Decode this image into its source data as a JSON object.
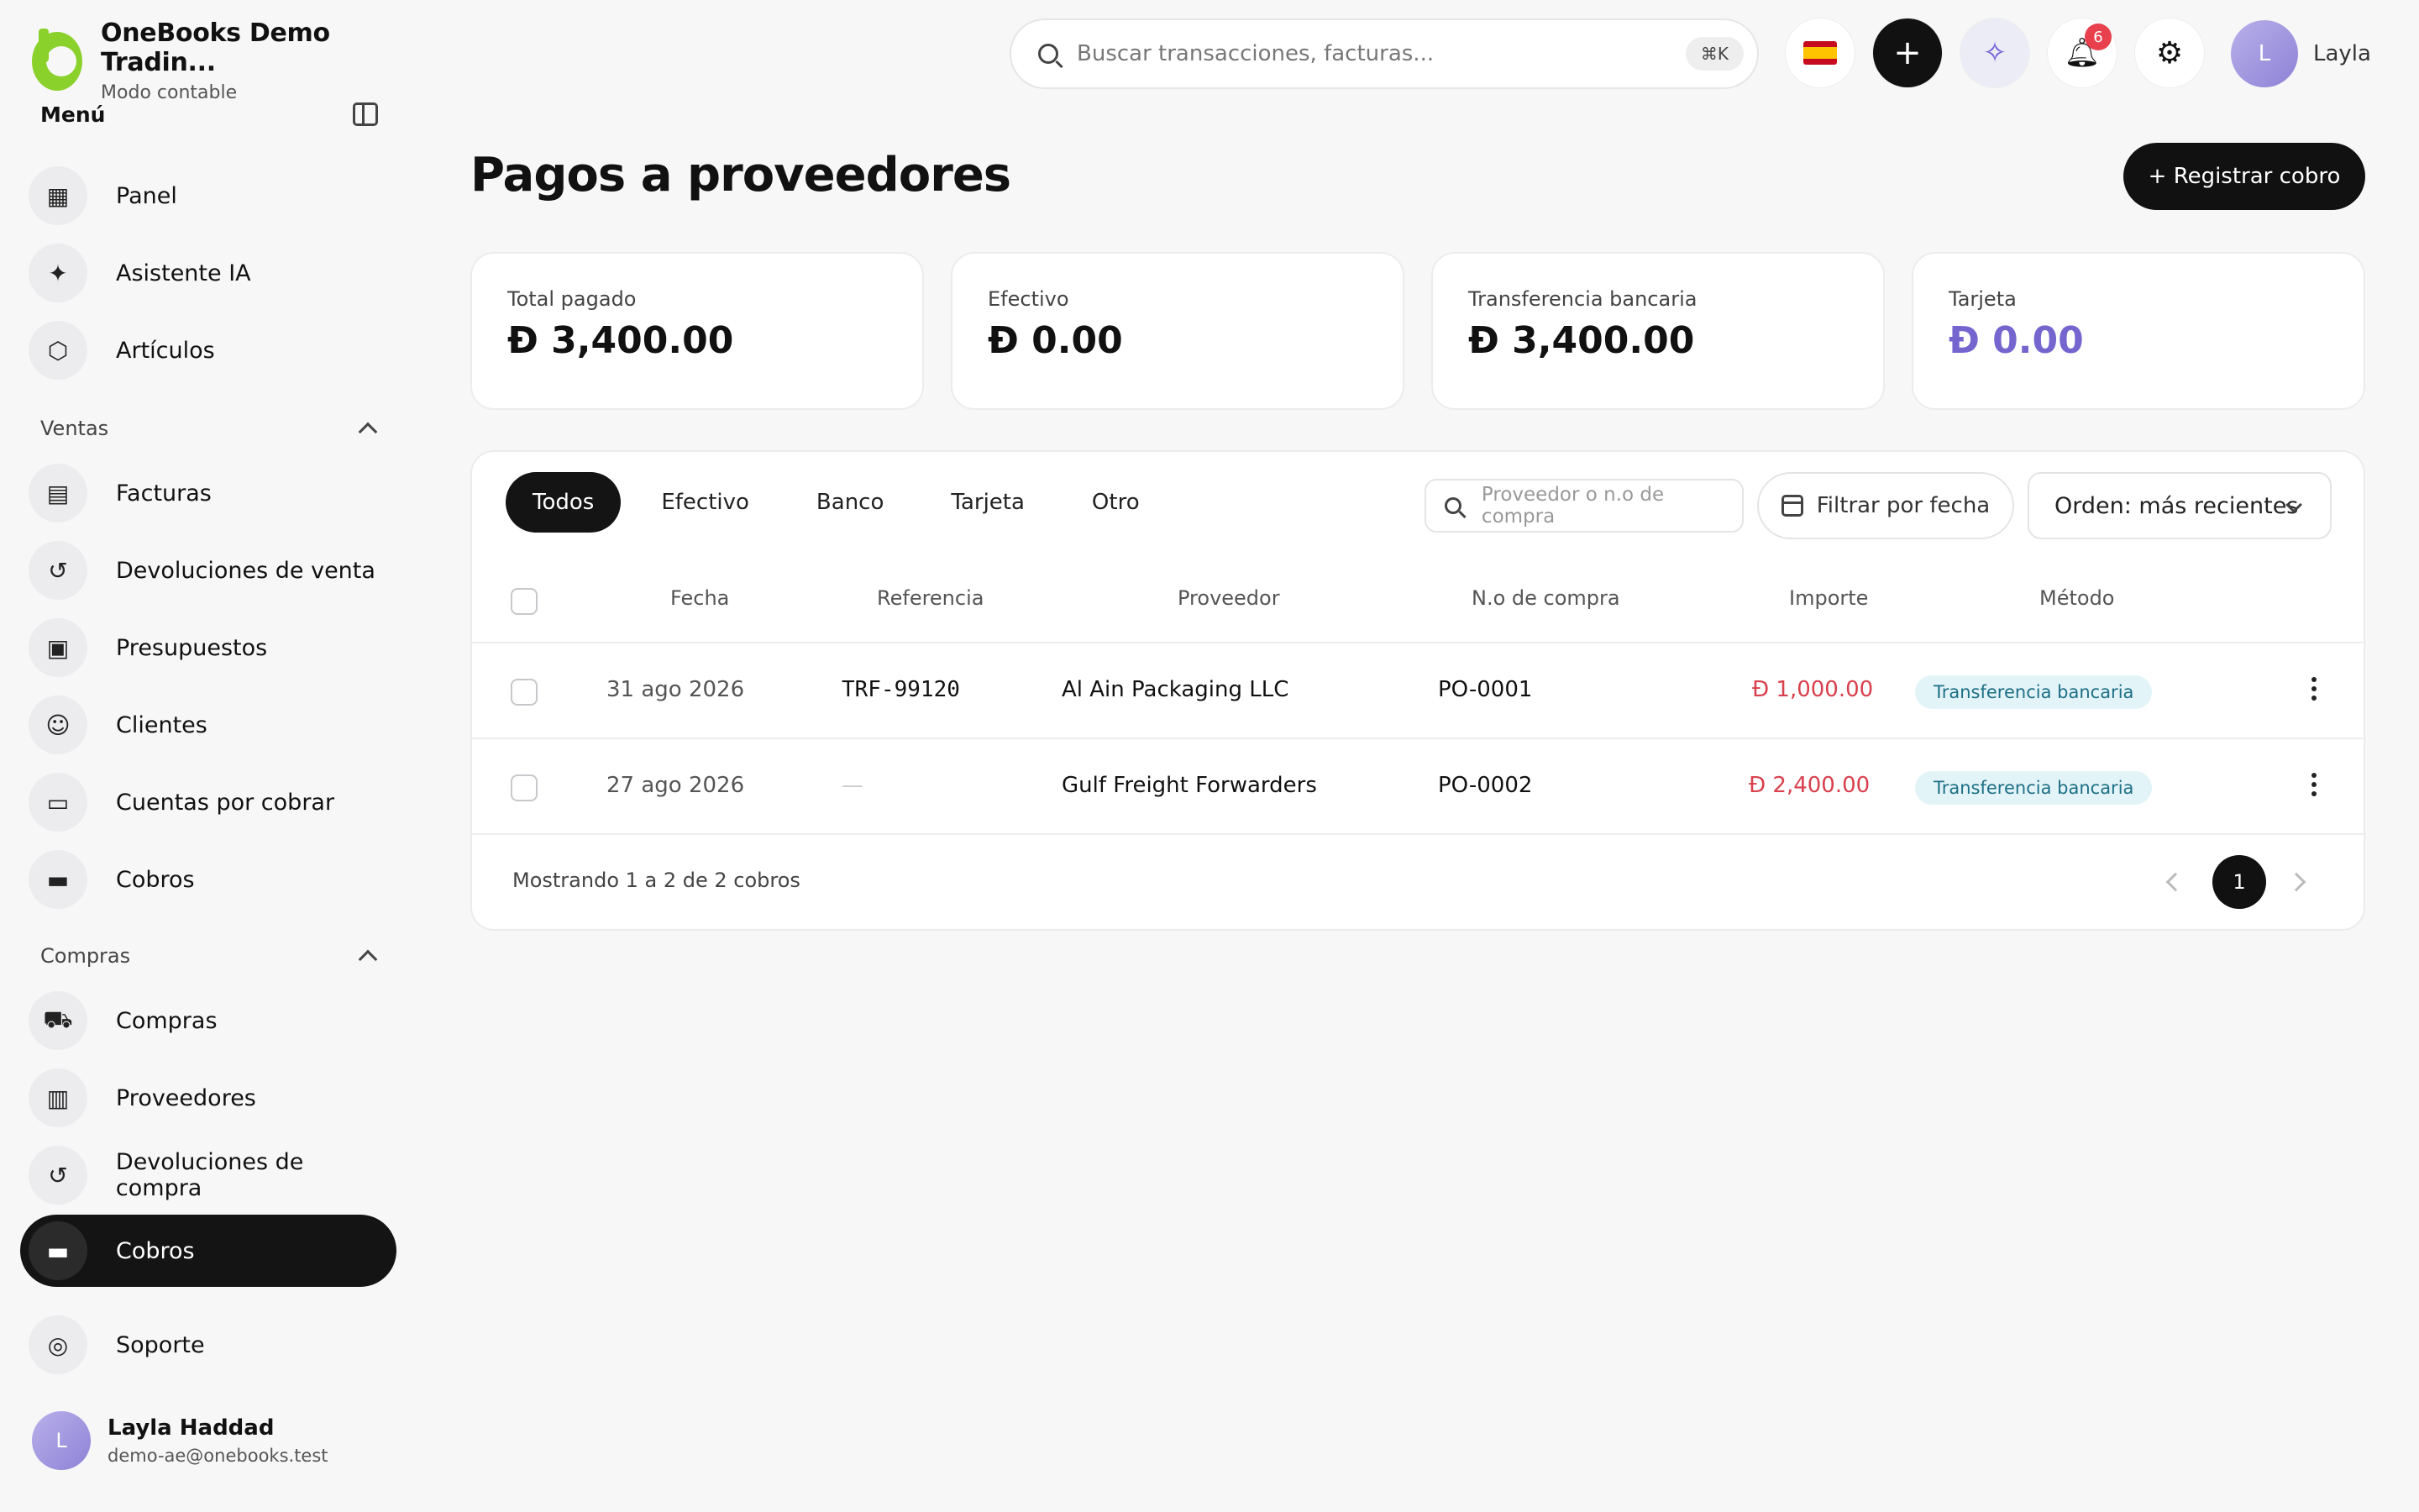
{
  "app": {
    "name": "OneBooks Demo Tradin...",
    "mode": "Modo contable"
  },
  "sidebar": {
    "menu_title": "Menú",
    "top_items": [
      {
        "label": "Panel",
        "icon": "grid-icon"
      },
      {
        "label": "Asistente IA",
        "icon": "sparkle-icon"
      },
      {
        "label": "Artículos",
        "icon": "box-icon"
      }
    ],
    "sections": [
      {
        "title": "Ventas",
        "items": [
          {
            "label": "Facturas",
            "icon": "document-icon"
          },
          {
            "label": "Devoluciones de venta",
            "icon": "undo-icon"
          },
          {
            "label": "Presupuestos",
            "icon": "clipboard-icon"
          },
          {
            "label": "Clientes",
            "icon": "users-icon"
          },
          {
            "label": "Cuentas por cobrar",
            "icon": "wallet-icon"
          },
          {
            "label": "Cobros",
            "icon": "card-icon"
          }
        ]
      },
      {
        "title": "Compras",
        "items": [
          {
            "label": "Compras",
            "icon": "cart-icon"
          },
          {
            "label": "Proveedores",
            "icon": "building-icon"
          },
          {
            "label": "Devoluciones de compra",
            "icon": "undo-icon"
          },
          {
            "label": "Cobros",
            "icon": "card-icon",
            "active": true
          }
        ]
      }
    ],
    "support": {
      "label": "Soporte",
      "icon": "lifebuoy-icon"
    },
    "user": {
      "initial": "L",
      "name": "Layla Haddad",
      "email": "demo-ae@onebooks.test"
    }
  },
  "topbar": {
    "search_placeholder": "Buscar transacciones, facturas...",
    "shortcut": "⌘K",
    "notifications_count": "6",
    "user_initial": "L",
    "user_name": "Layla"
  },
  "page": {
    "title": "Pagos a proveedores",
    "primary_button": "+ Registrar cobro"
  },
  "stats": [
    {
      "label": "Total pagado",
      "value": "Đ 3,400.00"
    },
    {
      "label": "Efectivo",
      "value": "Đ 0.00"
    },
    {
      "label": "Transferencia bancaria",
      "value": "Đ 3,400.00"
    },
    {
      "label": "Tarjeta",
      "value": "Đ 0.00"
    }
  ],
  "filters": {
    "tabs": [
      "Todos",
      "Efectivo",
      "Banco",
      "Tarjeta",
      "Otro"
    ],
    "active_tab": "Todos",
    "search_placeholder": "Proveedor o n.o de compra",
    "date_filter": "Filtrar por fecha",
    "sort": "Orden: más recientes"
  },
  "table": {
    "columns": [
      "Fecha",
      "Referencia",
      "Proveedor",
      "N.o de compra",
      "Importe",
      "Método"
    ],
    "rows": [
      {
        "date": "31 ago 2026",
        "reference": "TRF-99120",
        "supplier": "Al Ain Packaging LLC",
        "po": "PO-0001",
        "amount": "Đ 1,000.00",
        "method": "Transferencia bancaria"
      },
      {
        "date": "27 ago 2026",
        "reference": "—",
        "supplier": "Gulf Freight Forwarders",
        "po": "PO-0002",
        "amount": "Đ 2,400.00",
        "method": "Transferencia bancaria"
      }
    ],
    "footer": "Mostrando 1 a 2 de 2 cobros",
    "current_page": "1"
  }
}
